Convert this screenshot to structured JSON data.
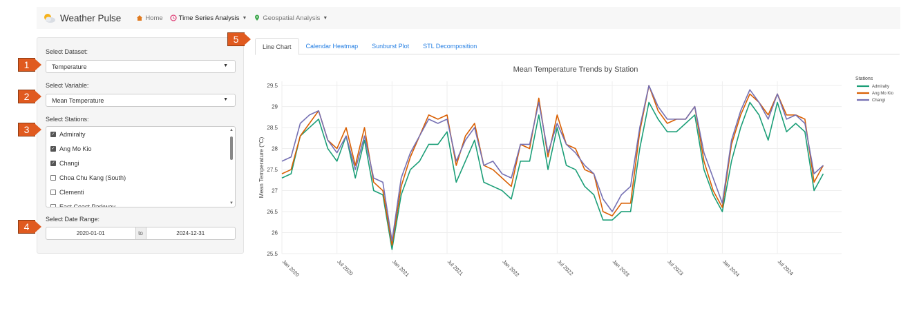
{
  "app": {
    "title": "Weather Pulse",
    "nav": {
      "home": "Home",
      "time_series": "Time Series Analysis",
      "geospatial": "Geospatial Analysis"
    }
  },
  "sidebar": {
    "dataset_label": "Select Dataset:",
    "dataset_value": "Temperature",
    "variable_label": "Select Variable:",
    "variable_value": "Mean Temperature",
    "stations_label": "Select Stations:",
    "stations": [
      {
        "label": "Admiralty",
        "checked": true
      },
      {
        "label": "Ang Mo Kio",
        "checked": true
      },
      {
        "label": "Changi",
        "checked": true
      },
      {
        "label": "Choa Chu Kang (South)",
        "checked": false
      },
      {
        "label": "Clementi",
        "checked": false
      },
      {
        "label": "East Coast Parkway",
        "checked": false
      }
    ],
    "date_label": "Select Date Range:",
    "date_start": "2020-01-01",
    "date_sep": "to",
    "date_end": "2024-12-31"
  },
  "badges": [
    "1",
    "2",
    "3",
    "4",
    "5"
  ],
  "tabs": [
    {
      "label": "Line Chart",
      "active": true
    },
    {
      "label": "Calendar Heatmap",
      "active": false
    },
    {
      "label": "Sunburst Plot",
      "active": false
    },
    {
      "label": "STL Decomposition",
      "active": false
    }
  ],
  "colors": {
    "accent": "#2780e3",
    "badge": "#e05a1f",
    "admiralty": "#1b9e77",
    "ang_mo_kio": "#d95f02",
    "changi": "#7570b3"
  },
  "chart_data": {
    "type": "line",
    "title": "Mean Temperature Trends by Station",
    "xlabel": "",
    "ylabel": "Mean Temperature (°C)",
    "ylim": [
      25.5,
      29.6
    ],
    "yticks": [
      25.5,
      26,
      26.5,
      27,
      27.5,
      28,
      28.5,
      29,
      29.5
    ],
    "xlim": [
      0,
      61
    ],
    "xtick_positions": [
      0,
      6,
      12,
      18,
      24,
      30,
      36,
      42,
      48,
      54
    ],
    "xtick_labels": [
      "Jan 2020",
      "Jul 2020",
      "Jan 2021",
      "Jul 2021",
      "Jan 2022",
      "Jul 2022",
      "Jan 2023",
      "Jul 2023",
      "Jan 2024",
      "Jul 2024"
    ],
    "legend_title": "Stations",
    "legend_position": "right",
    "grid": true,
    "x": [
      "2020-01",
      "2020-02",
      "2020-03",
      "2020-04",
      "2020-05",
      "2020-06",
      "2020-07",
      "2020-08",
      "2020-09",
      "2020-10",
      "2020-11",
      "2020-12",
      "2021-01",
      "2021-02",
      "2021-03",
      "2021-04",
      "2021-05",
      "2021-06",
      "2021-07",
      "2021-08",
      "2021-09",
      "2021-10",
      "2021-11",
      "2021-12",
      "2022-01",
      "2022-02",
      "2022-03",
      "2022-04",
      "2022-05",
      "2022-06",
      "2022-07",
      "2022-08",
      "2022-09",
      "2022-10",
      "2022-11",
      "2022-12",
      "2023-01",
      "2023-02",
      "2023-03",
      "2023-04",
      "2023-05",
      "2023-06",
      "2023-07",
      "2023-08",
      "2023-09",
      "2023-10",
      "2023-11",
      "2023-12",
      "2024-01",
      "2024-02",
      "2024-03",
      "2024-04",
      "2024-05",
      "2024-06",
      "2024-07",
      "2024-08",
      "2024-09",
      "2024-10",
      "2024-11",
      "2024-12"
    ],
    "series": [
      {
        "name": "Admiralty",
        "color": "#1b9e77",
        "values": [
          27.3,
          27.4,
          28.3,
          28.5,
          28.7,
          28.0,
          27.7,
          28.3,
          27.3,
          28.2,
          27.0,
          26.9,
          25.6,
          26.9,
          27.5,
          27.7,
          28.1,
          28.1,
          28.4,
          27.2,
          27.7,
          28.2,
          27.2,
          27.1,
          27.0,
          26.8,
          27.7,
          27.7,
          28.8,
          27.5,
          28.5,
          27.6,
          27.5,
          27.1,
          26.9,
          26.3,
          26.3,
          26.5,
          26.5,
          28.0,
          29.1,
          28.7,
          28.4,
          28.4,
          28.6,
          28.8,
          27.5,
          26.9,
          26.5,
          27.7,
          28.5,
          29.1,
          28.8,
          28.2,
          29.1,
          28.4,
          28.6,
          28.4,
          27.0,
          27.4
        ]
      },
      {
        "name": "Ang Mo Kio",
        "color": "#d95f02",
        "values": [
          27.4,
          27.5,
          28.3,
          28.6,
          28.9,
          28.2,
          28.0,
          28.5,
          27.6,
          28.5,
          27.2,
          27.0,
          25.7,
          27.1,
          27.8,
          28.3,
          28.8,
          28.7,
          28.8,
          27.6,
          28.3,
          28.6,
          27.6,
          27.5,
          27.3,
          27.1,
          28.1,
          28.0,
          29.2,
          27.8,
          28.8,
          28.1,
          28.0,
          27.5,
          27.4,
          26.5,
          26.4,
          26.7,
          26.7,
          28.4,
          29.5,
          28.9,
          28.6,
          28.7,
          28.7,
          29.0,
          27.7,
          27.0,
          26.6,
          28.1,
          28.8,
          29.3,
          29.1,
          28.8,
          29.3,
          28.8,
          28.8,
          28.7,
          27.2,
          27.6
        ]
      },
      {
        "name": "Changi",
        "color": "#7570b3",
        "values": [
          27.7,
          27.8,
          28.6,
          28.8,
          28.9,
          28.2,
          27.9,
          28.3,
          27.5,
          28.3,
          27.3,
          27.2,
          25.8,
          27.3,
          27.9,
          28.3,
          28.7,
          28.6,
          28.7,
          27.7,
          28.2,
          28.5,
          27.6,
          27.7,
          27.4,
          27.3,
          28.1,
          28.1,
          29.1,
          27.9,
          28.6,
          28.1,
          27.9,
          27.6,
          27.4,
          26.8,
          26.5,
          26.9,
          27.1,
          28.5,
          29.5,
          29.0,
          28.7,
          28.7,
          28.7,
          29.0,
          27.9,
          27.3,
          26.7,
          28.2,
          28.9,
          29.4,
          29.1,
          28.7,
          29.3,
          28.7,
          28.8,
          28.6,
          27.4,
          27.6
        ]
      }
    ]
  }
}
